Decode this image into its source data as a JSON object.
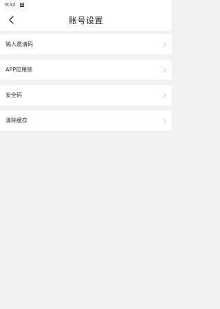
{
  "status_bar": {
    "time": "9:32"
  },
  "header": {
    "title": "账号设置",
    "back_icon": "chevron-left-icon"
  },
  "menu": {
    "items": [
      {
        "label": "输入邀请码"
      },
      {
        "label": "APP应用锁"
      },
      {
        "label": "安全码"
      },
      {
        "label": "清除缓存"
      }
    ]
  },
  "colors": {
    "background": "#f2f2f2",
    "card": "#ffffff",
    "text": "#333333",
    "chevron": "#cccccc"
  }
}
